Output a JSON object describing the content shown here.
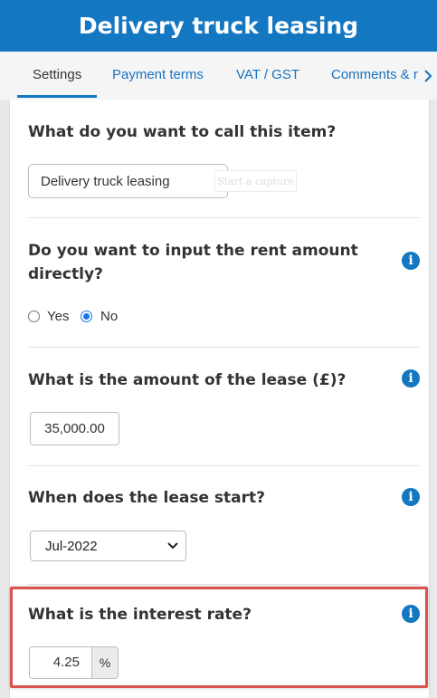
{
  "header": {
    "title": "Delivery truck leasing"
  },
  "tabs": [
    {
      "label": "Settings",
      "active": true
    },
    {
      "label": "Payment terms"
    },
    {
      "label": "VAT / GST"
    },
    {
      "label": "Comments & r"
    }
  ],
  "sections": {
    "name": {
      "question": "What do you want to call this item?",
      "value": "Delivery truck leasing",
      "capture_label": "Start a capture"
    },
    "rent_direct": {
      "question_line1": "Do you want to input the rent amount",
      "question_line2": "directly?",
      "options": [
        "Yes",
        "No"
      ],
      "selected": "No"
    },
    "lease_amount": {
      "question": "What is the amount of the lease (£)?",
      "value": "35,000.00"
    },
    "lease_start": {
      "question": "When does the lease start?",
      "selected": "Jul-2022"
    },
    "interest_rate": {
      "question": "What is the interest rate?",
      "value": "4.25",
      "unit": "%"
    }
  },
  "icons": {
    "info": "i"
  },
  "colors": {
    "brand": "#1477c2",
    "highlight": "#d9534f"
  }
}
